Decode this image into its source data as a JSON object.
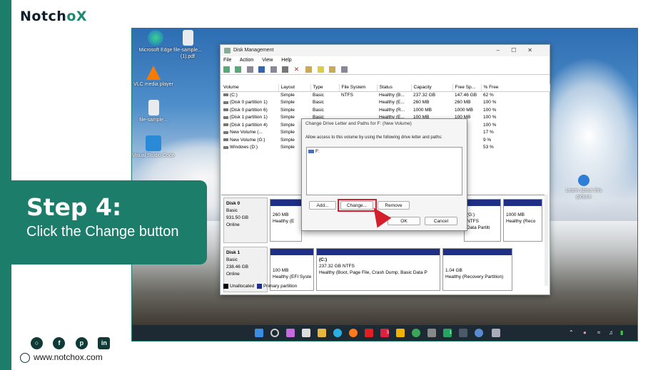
{
  "brand": {
    "logo_main": "Notch",
    "logo_accent": "oX",
    "website": "www.notchox.com"
  },
  "callout": {
    "step": "Step 4:",
    "description": "Click the Change button"
  },
  "social": [
    "instagram-icon",
    "facebook-icon",
    "pinterest-icon",
    "linkedin-icon"
  ],
  "desktop_icons": [
    {
      "label": "Microsoft Edge"
    },
    {
      "label": "file-sample... (1).pdf"
    },
    {
      "label": "VLC media player"
    },
    {
      "label": "file-sample..."
    },
    {
      "label": "Visual Studio Code"
    },
    {
      "label": "Learn about this picture"
    }
  ],
  "disk_management": {
    "title": "Disk Management",
    "menu": [
      "File",
      "Action",
      "View",
      "Help"
    ],
    "columns": [
      "Volume",
      "Layout",
      "Type",
      "File System",
      "Status",
      "Capacity",
      "Free Sp...",
      "% Free"
    ],
    "rows": [
      [
        "(C:)",
        "Simple",
        "Basic",
        "NTFS",
        "Healthy (B...",
        "237.32 GB",
        "147.46 GB",
        "62 %"
      ],
      [
        "(Disk 0 partition 1)",
        "Simple",
        "Basic",
        "",
        "Healthy (E...",
        "260 MB",
        "260 MB",
        "100 %"
      ],
      [
        "(Disk 0 partition 6)",
        "Simple",
        "Basic",
        "",
        "Healthy (R...",
        "1000 MB",
        "1000 MB",
        "100 %"
      ],
      [
        "(Disk 1 partition 1)",
        "Simple",
        "Basic",
        "",
        "Healthy (E...",
        "100 MB",
        "100 MB",
        "100 %"
      ],
      [
        "(Disk 1 partition 4)",
        "Simple",
        "",
        "",
        "",
        "",
        "GB",
        "100 %"
      ],
      [
        "New Volume (...",
        "Simple",
        "",
        "",
        "",
        "",
        "GB",
        "17 %"
      ],
      [
        "New Volume (G:)",
        "Simple",
        "",
        "",
        "",
        "",
        "MB",
        "9 %"
      ],
      [
        "Windows (D:)",
        "Simple",
        "",
        "",
        "",
        "",
        "GB",
        "53 %"
      ]
    ],
    "disk0": {
      "name": "Disk 0",
      "type": "Basic",
      "size": "931.50 GB",
      "status": "Online",
      "parts": [
        {
          "l1": "260 MB",
          "l2": "Healthy (E"
        },
        {
          "l1": "(G:)",
          "l2": "NTFS"
        },
        {
          "l1": "",
          "l2": "Data Partiti"
        },
        {
          "l1": "1000 MB",
          "l2": "Healthy (Reco"
        }
      ]
    },
    "disk1": {
      "name": "Disk 1",
      "type": "Basic",
      "size": "238.46 GB",
      "status": "Online",
      "parts": [
        {
          "l0": "",
          "l1": "100 MB",
          "l2": "Healthy (EFI Syste"
        },
        {
          "l0": "(C:)",
          "l1": "237.32 GB NTFS",
          "l2": "Healthy (Boot, Page File, Crash Dump, Basic Data P"
        },
        {
          "l0": "",
          "l1": "1.04 GB",
          "l2": "Healthy (Recovery Partition)"
        }
      ]
    },
    "legend": {
      "unallocated": "Unallocated",
      "primary": "Primary partition"
    }
  },
  "dialog": {
    "title": "Change Drive Letter and Paths for F: (New Volume)",
    "text": "Allow access to this volume by using the following drive letter and paths:",
    "item": "F:",
    "add": "Add...",
    "change": "Change...",
    "remove": "Remove",
    "ok": "OK",
    "cancel": "Cancel"
  },
  "taskbar": {
    "badge1": "3",
    "badge2": "1"
  },
  "colors": {
    "brand_teal": "#1c7d6b",
    "highlight_red": "#e01a2a",
    "partition_blue": "#1f2f86"
  }
}
